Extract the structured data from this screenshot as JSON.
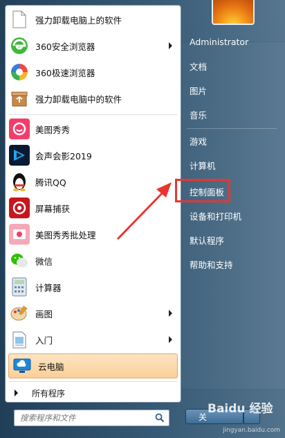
{
  "programs": [
    {
      "label": "强力卸载电脑上的软件",
      "icon": "document-icon"
    },
    {
      "label": "360安全浏览器",
      "icon": "browser-360-icon",
      "has_submenu": true
    },
    {
      "label": "360极速浏览器",
      "icon": "browser-360-speed-icon"
    },
    {
      "label": "强力卸载电脑中的软件",
      "icon": "recycle-box-icon"
    },
    {
      "label": "美图秀秀",
      "icon": "meitu-icon"
    },
    {
      "label": "会声会影2019",
      "icon": "video-editor-icon"
    },
    {
      "label": "腾讯QQ",
      "icon": "qq-penguin-icon"
    },
    {
      "label": "屏幕捕获",
      "icon": "screen-capture-icon"
    },
    {
      "label": "美图秀秀批处理",
      "icon": "meitu-batch-icon"
    },
    {
      "label": "微信",
      "icon": "wechat-icon"
    },
    {
      "label": "计算器",
      "icon": "calculator-icon"
    },
    {
      "label": "画图",
      "icon": "paint-icon",
      "has_submenu": true
    },
    {
      "label": "入门",
      "icon": "getting-started-icon",
      "has_submenu": true
    },
    {
      "label": "云电脑",
      "icon": "cloud-pc-icon",
      "highlighted": true
    }
  ],
  "all_programs_label": "所有程序",
  "search": {
    "placeholder": "搜索程序和文件"
  },
  "right_links": [
    {
      "label": "Administrator"
    },
    {
      "label": "文档"
    },
    {
      "label": "图片"
    },
    {
      "label": "音乐"
    },
    {
      "label": "游戏"
    },
    {
      "label": "计算机"
    },
    {
      "label": "控制面板",
      "highlighted": true
    },
    {
      "label": "设备和打印机"
    },
    {
      "label": "默认程序"
    },
    {
      "label": "帮助和支持"
    }
  ],
  "shutdown_label": "关",
  "watermark": "Baidu 经验",
  "watermark_url": "jingyan.baidu.com",
  "colors": {
    "highlight_box": "#e8362f",
    "arrow": "#e8362f",
    "selected_item": "#fbcf97"
  }
}
